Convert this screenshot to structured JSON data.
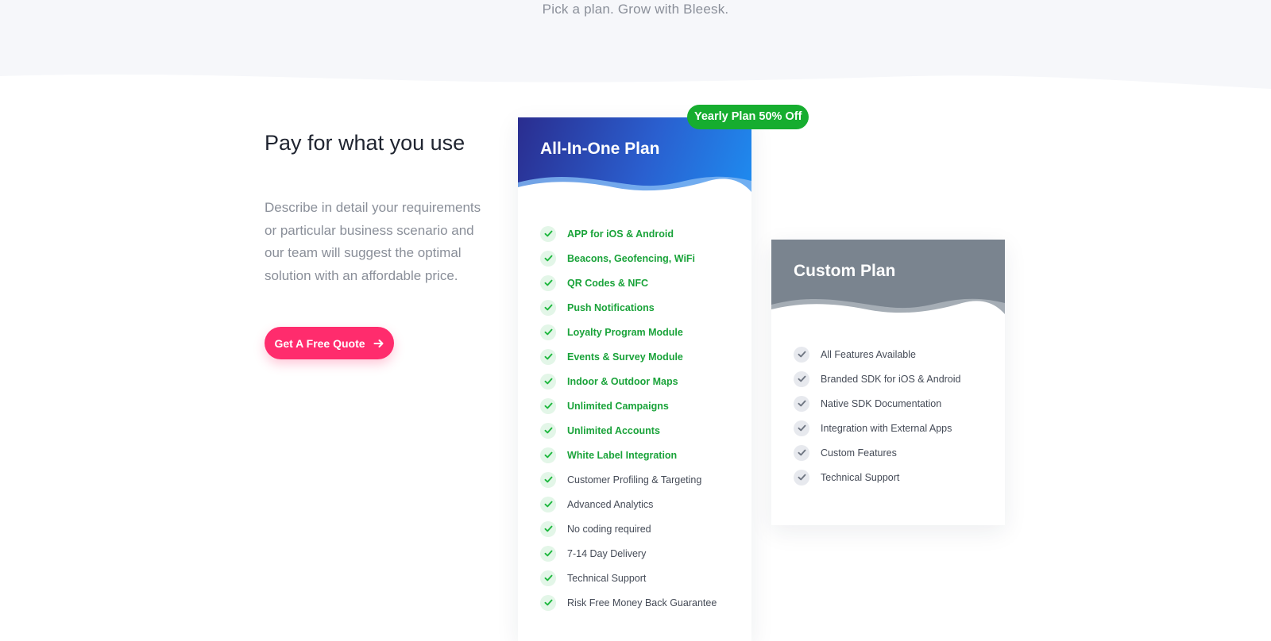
{
  "header": {
    "tagline": "Pick a plan. Grow with Bleesk."
  },
  "intro": {
    "title": "Pay for what you use",
    "description": "Describe in detail your requirements or particular business scenario and our team will suggest the optimal solution with an affordable price.",
    "button_label": "Get A Free Quote",
    "button_icon": "arrow-right-icon"
  },
  "plans": [
    {
      "name": "All-In-One Plan",
      "badge": "Yearly Plan 50% Off",
      "features": [
        {
          "text": "APP for iOS & Android",
          "highlight": true
        },
        {
          "text": "Beacons, Geofencing, WiFi",
          "highlight": true
        },
        {
          "text": "QR Codes & NFC",
          "highlight": true
        },
        {
          "text": "Push Notifications",
          "highlight": true
        },
        {
          "text": "Loyalty Program Module",
          "highlight": true
        },
        {
          "text": "Events & Survey Module",
          "highlight": true
        },
        {
          "text": "Indoor & Outdoor Maps",
          "highlight": true
        },
        {
          "text": "Unlimited Campaigns",
          "highlight": true
        },
        {
          "text": "Unlimited Accounts",
          "highlight": true
        },
        {
          "text": "White Label Integration",
          "highlight": true
        },
        {
          "text": "Customer Profiling & Targeting",
          "highlight": false
        },
        {
          "text": "Advanced Analytics",
          "highlight": false
        },
        {
          "text": "No coding required",
          "highlight": false
        },
        {
          "text": "7-14 Day Delivery",
          "highlight": false
        },
        {
          "text": "Technical Support",
          "highlight": false
        },
        {
          "text": "Risk Free Money Back Guarantee",
          "highlight": false
        }
      ]
    },
    {
      "name": "Custom Plan",
      "features": [
        {
          "text": "All Features Available",
          "highlight": false
        },
        {
          "text": "Branded SDK for iOS & Android",
          "highlight": false
        },
        {
          "text": "Native SDK Documentation",
          "highlight": false
        },
        {
          "text": "Integration with External Apps",
          "highlight": false
        },
        {
          "text": "Custom Features",
          "highlight": false
        },
        {
          "text": "Technical Support",
          "highlight": false
        }
      ]
    }
  ],
  "colors": {
    "accent_pink": "#ff2c6d",
    "badge_green": "#16ad2f",
    "feature_green": "#1aa33a",
    "check_green": "#1fb83f",
    "check_grey": "#6f7682",
    "allinone_header_start": "#2a2d8f",
    "allinone_header_end": "#1e8cf0",
    "custom_header": "#7a848f"
  }
}
